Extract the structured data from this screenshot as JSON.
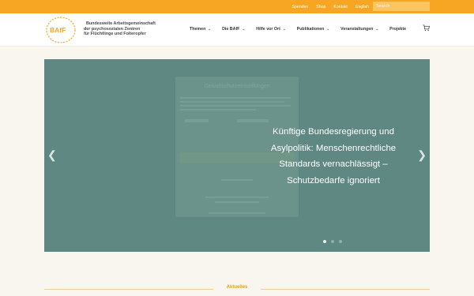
{
  "topbar": {
    "links": [
      "Spenden",
      "Shop",
      "Kontakt",
      "English"
    ],
    "search_placeholder": "Search",
    "accent": "#f6a623"
  },
  "header": {
    "logo_letters": "BAfF",
    "org_lines": [
      "Bundesweite Arbeitsgemeinschaft",
      "der psychosozialen Zentren",
      "für Flüchtlinge und Folteropfer"
    ],
    "nav": [
      {
        "label": "Themen",
        "dropdown": true
      },
      {
        "label": "Die BAfF",
        "dropdown": true
      },
      {
        "label": "Hilfe vor Ort",
        "dropdown": true
      },
      {
        "label": "Publikationen",
        "dropdown": true
      },
      {
        "label": "Veranstaltungen",
        "dropdown": true
      },
      {
        "label": "Projekte",
        "dropdown": false
      }
    ],
    "cart_icon": "shopping-cart-icon"
  },
  "slider": {
    "overlay_title": "Gewaltschutzeinstellungen",
    "headline": "Künftige Bundesregierung und Asylpolitik: Menschenrechtliche Standards vernachlässigt – Schutzbedarfe ignoriert",
    "slide_count": 3,
    "active_slide": 1,
    "bg_color": "#5f8882"
  },
  "section": {
    "title": "Aktuelles"
  }
}
